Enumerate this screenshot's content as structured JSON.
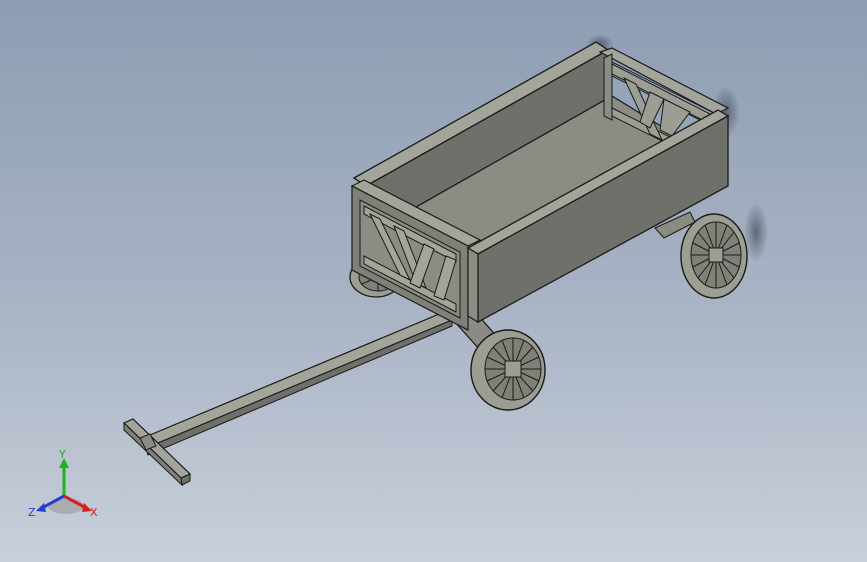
{
  "viewport": {
    "background_top": "#8d9db3",
    "background_bottom": "#c9cfda"
  },
  "model": {
    "body_color": "#6f706a",
    "edge_color": "#1a1a18",
    "light_face": "#a3a59b",
    "wheel_color": "#9c9e94"
  },
  "triad": {
    "x_label": "X",
    "y_label": "Y",
    "z_label": "Z",
    "x_color": "#d42020",
    "y_color": "#20b020",
    "z_color": "#2040d0"
  }
}
